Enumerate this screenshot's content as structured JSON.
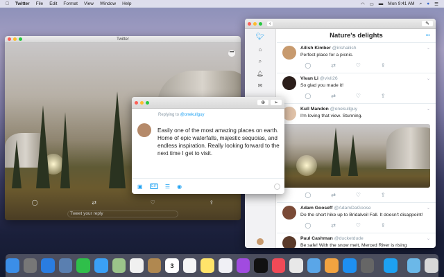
{
  "menubar": {
    "app": "Twitter",
    "items": [
      "File",
      "Edit",
      "Format",
      "View",
      "Window",
      "Help"
    ],
    "clock": "Mon 9:41 AM"
  },
  "left_window": {
    "title": "Twitter",
    "reply_placeholder": "Tweet your reply"
  },
  "right_window": {
    "title": "Nature's delights",
    "tweets": [
      {
        "name": "Ailish Kimber",
        "handle": "@irishailish",
        "text": "Perfect place for a picnic.",
        "avatar": "#c79a6e"
      },
      {
        "name": "Vivan Li",
        "handle": "@vivli26",
        "text": "So glad you made it!",
        "avatar": "#2b1e1a"
      },
      {
        "name": "Kull Mandon",
        "handle": "@onekullguy",
        "text": "I'm loving that view. Stunning.",
        "avatar": "#e0c2a8"
      },
      {
        "name": "Adam Gooseff",
        "handle": "@AdamDaGoose",
        "text": "Do the short hike up to Bridalveil Fall. It doesn't disappoint!",
        "avatar": "#7a4a36"
      },
      {
        "name": "Paul Cashman",
        "handle": "@ducketdude",
        "text": "Be safe! With the snow melt, Merced River is rising",
        "avatar": "#5a3a2a"
      }
    ]
  },
  "compose": {
    "replying_label": "Replying to",
    "replying_handle": "@onekullguy",
    "text": "Easily one of the most amazing places on earth. Home of epic waterfalls, majestic sequoias, and endless inspiration. Really looking forward to the next time I get to visit.",
    "gif_label": "GIF"
  },
  "dock": [
    {
      "name": "finder",
      "color": "#3b8ee8"
    },
    {
      "name": "launchpad",
      "color": "#777"
    },
    {
      "name": "safari",
      "color": "#2a7de1"
    },
    {
      "name": "preview",
      "color": "#5a7fb0"
    },
    {
      "name": "facetime",
      "color": "#2fbf4a"
    },
    {
      "name": "messages",
      "color": "#3aa0f5"
    },
    {
      "name": "maps",
      "color": "#9bc48a"
    },
    {
      "name": "photos",
      "color": "#f0f0f0"
    },
    {
      "name": "contacts",
      "color": "#b08850"
    },
    {
      "name": "calendar",
      "color": "#ffffff",
      "label": "3"
    },
    {
      "name": "reminders",
      "color": "#f5f5f5"
    },
    {
      "name": "notes",
      "color": "#ffe46a"
    },
    {
      "name": "music",
      "color": "#f0f0f5"
    },
    {
      "name": "podcasts",
      "color": "#a14be0"
    },
    {
      "name": "tv",
      "color": "#111"
    },
    {
      "name": "news",
      "color": "#f04a57"
    },
    {
      "name": "numbers",
      "color": "#e8e8e8"
    },
    {
      "name": "keynote",
      "color": "#5aa6e8"
    },
    {
      "name": "pages",
      "color": "#f2a340"
    },
    {
      "name": "app-store",
      "color": "#1e8ff0"
    },
    {
      "name": "system-preferences",
      "color": "#666"
    },
    {
      "name": "twitter",
      "color": "#1da1f2"
    },
    {
      "name": "downloads",
      "color": "#6bb8e8"
    },
    {
      "name": "trash",
      "color": "#d8d8d8"
    }
  ]
}
